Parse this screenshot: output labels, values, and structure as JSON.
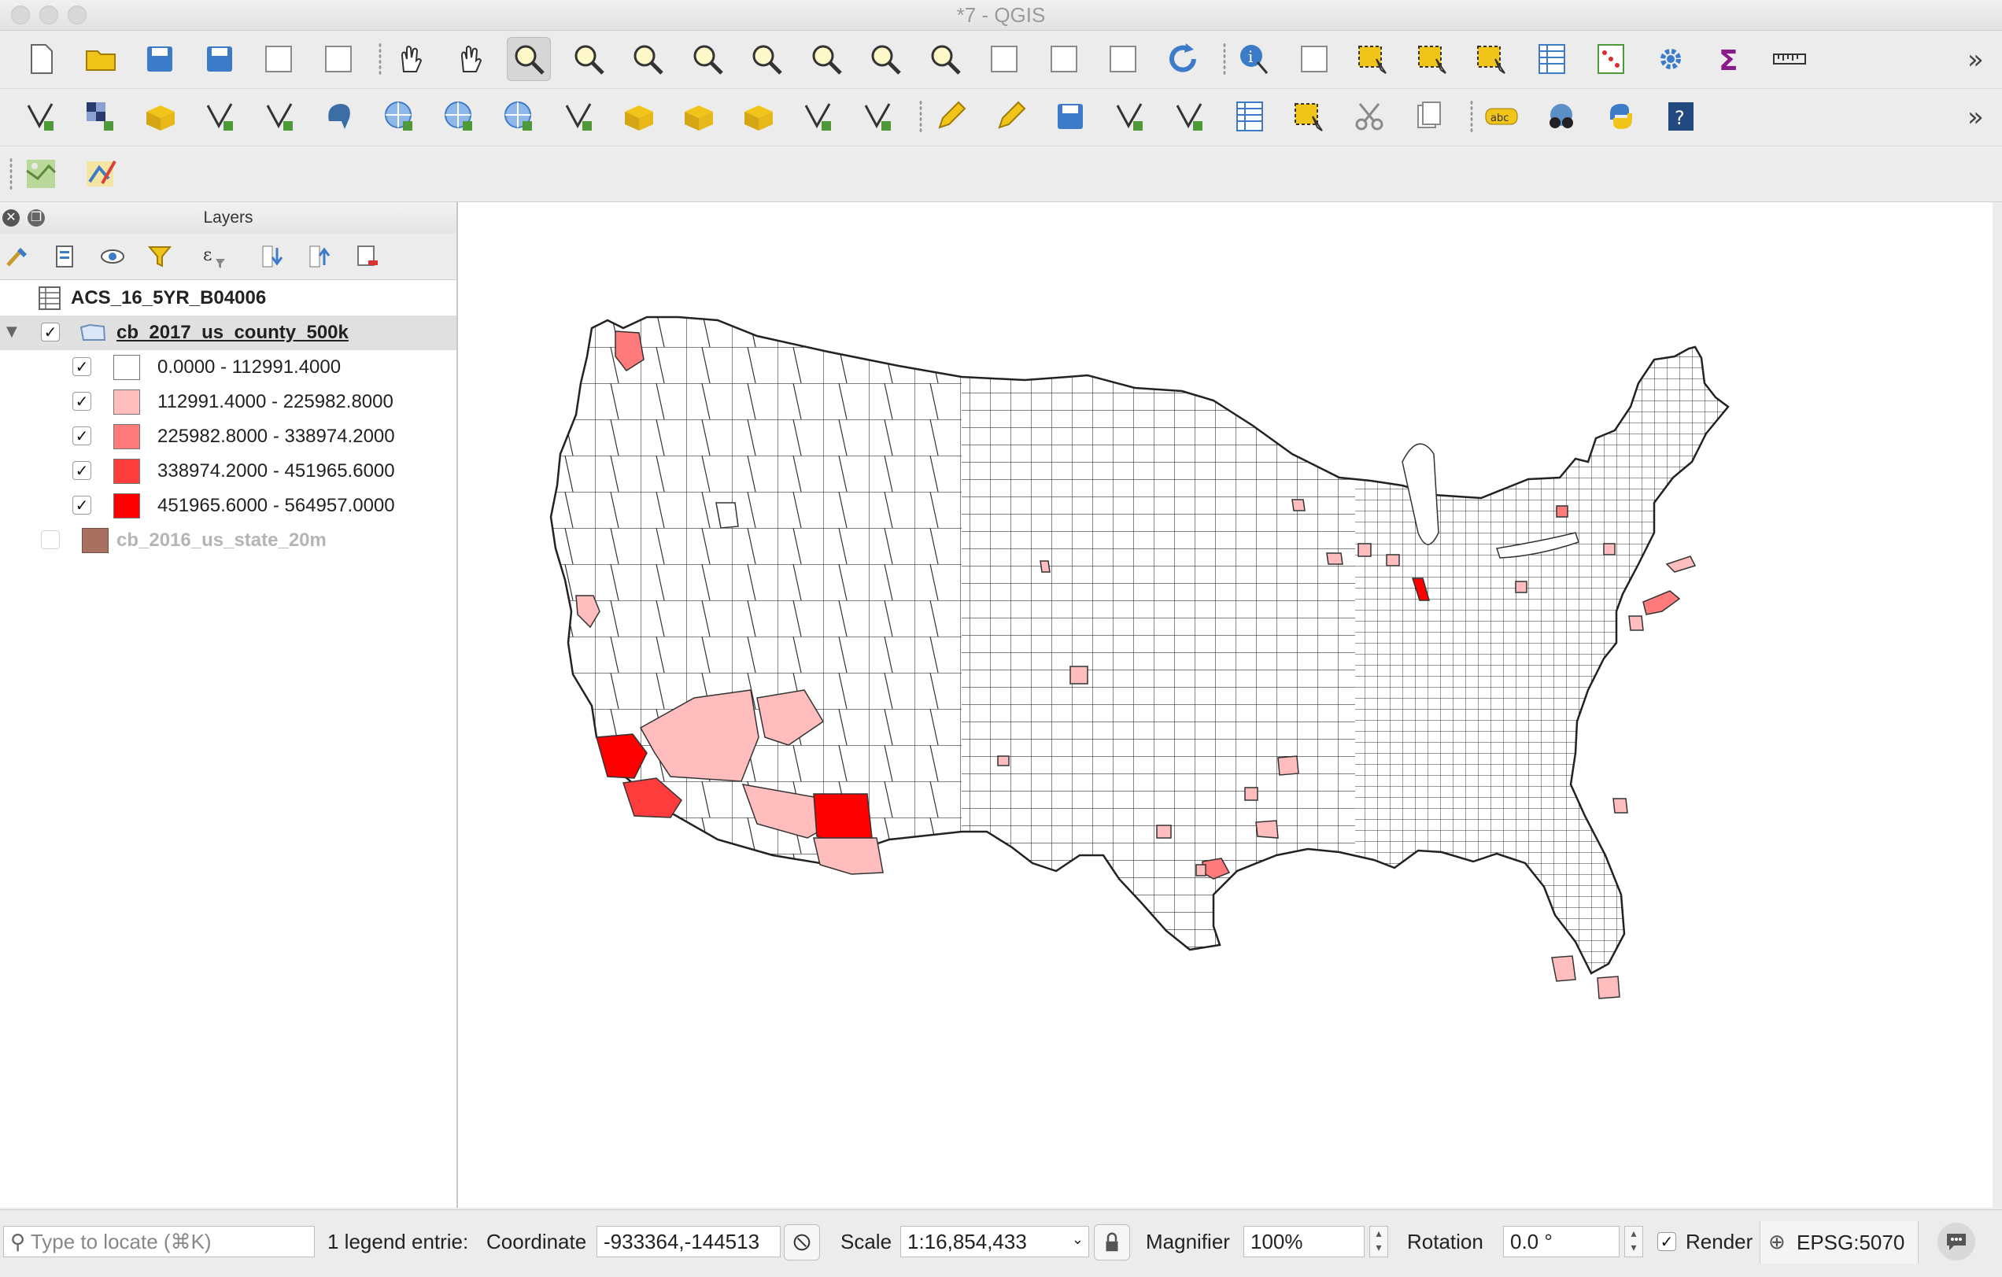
{
  "window": {
    "title": "*7 - QGIS"
  },
  "layers_panel": {
    "title": "Layers",
    "items": [
      {
        "name": "ACS_16_5YR_B04006",
        "type": "table"
      },
      {
        "name": "cb_2017_us_county_500k",
        "checked": true,
        "expanded": true,
        "selected": true
      },
      {
        "name": "cb_2016_us_state_20m",
        "checked": false,
        "color": "#a87060"
      }
    ],
    "legend": [
      {
        "label": "0.0000 - 112991.4000",
        "color": "#ffffff",
        "checked": true
      },
      {
        "label": "112991.4000 - 225982.8000",
        "color": "#ffbdbd",
        "checked": true
      },
      {
        "label": "225982.8000 - 338974.2000",
        "color": "#ff7b7b",
        "checked": true
      },
      {
        "label": "338974.2000 - 451965.6000",
        "color": "#ff3c3c",
        "checked": true
      },
      {
        "label": "451965.6000 - 564957.0000",
        "color": "#ff0000",
        "checked": true
      }
    ]
  },
  "status": {
    "locate_placeholder": "Type to locate (⌘K)",
    "legend_entries": "1 legend entrie:",
    "coordinate_label": "Coordinate",
    "coordinate_value": "-933364,-144513",
    "scale_label": "Scale",
    "scale_value": "1:16,854,433",
    "magnifier_label": "Magnifier",
    "magnifier_value": "100%",
    "rotation_label": "Rotation",
    "rotation_value": "0.0 °",
    "render_label": "Render",
    "render_checked": true,
    "crs": "EPSG:5070"
  },
  "map": {
    "colors": {
      "class1": "#ffffff",
      "class2": "#ffbdbd",
      "class3": "#ff7b7b",
      "class4": "#ff3c3c",
      "class5": "#ff0000",
      "outline": "#333333"
    }
  },
  "icons": {
    "toolbar1": [
      "new-project-icon",
      "open-project-icon",
      "save-project-icon",
      "save-as-icon",
      "new-print-layout-icon",
      "layout-manager-icon",
      "pan-icon",
      "pan-to-selection-icon",
      "zoom-in-icon",
      "zoom-out-icon",
      "zoom-native-icon",
      "zoom-full-icon",
      "zoom-to-selection-icon",
      "zoom-to-layer-icon",
      "zoom-last-icon",
      "zoom-next-icon",
      "new-bookmark-icon",
      "show-bookmarks-icon",
      "new-map-view-icon",
      "refresh-icon",
      "identify-icon",
      "action-icon",
      "select-features-icon",
      "select-by-value-icon",
      "deselect-icon",
      "attribute-table-icon",
      "field-calculator-icon",
      "processing-toolbox-icon",
      "statistics-icon",
      "measure-icon"
    ],
    "toolbar2": [
      "add-vector-layer-icon",
      "add-raster-layer-icon",
      "add-spatialite-icon",
      "add-delimited-text-icon",
      "add-gpx-icon",
      "add-postgis-icon",
      "add-wms-icon",
      "add-wfs-icon",
      "add-wcs-icon",
      "add-virtual-layer-icon",
      "new-geopackage-icon",
      "new-shapefile-icon",
      "new-spatialite-icon",
      "new-temporary-layer-icon",
      "new-virtual-layer-icon",
      "current-edits-icon",
      "toggle-editing-icon",
      "save-edits-icon",
      "add-feature-icon",
      "vertex-tool-icon",
      "modify-attributes-icon",
      "delete-selected-icon",
      "cut-features-icon",
      "copy-features-icon",
      "label-icon",
      "metasearch-icon",
      "python-console-icon",
      "help-icon"
    ]
  }
}
